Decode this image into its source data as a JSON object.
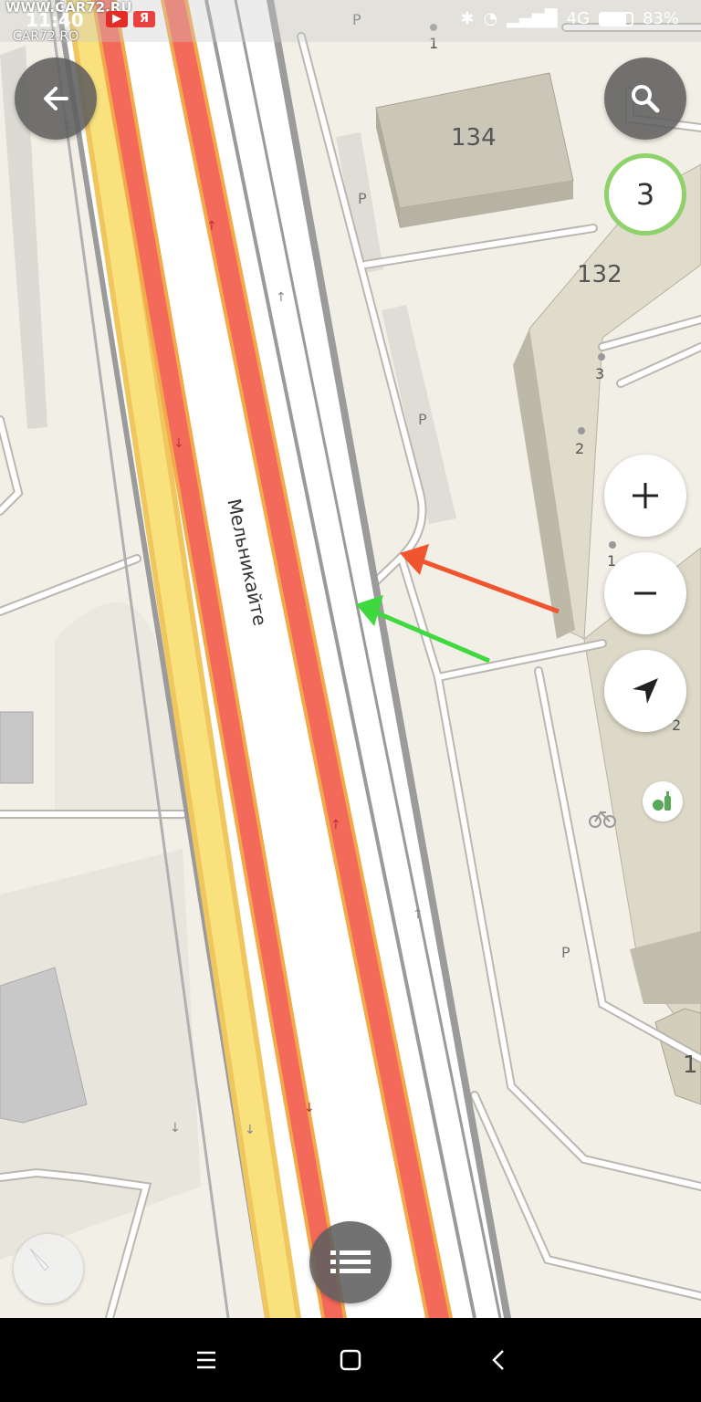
{
  "status_bar": {
    "time": "11:40",
    "network": "4G",
    "battery": "83%",
    "watermark_top": "WWW.CAR72.RU",
    "watermark_logo": "CAR72.RO",
    "yandex_badge": "Я"
  },
  "map": {
    "street_name": "Мельникайте",
    "buildings": [
      {
        "label": "134"
      },
      {
        "label": "132"
      },
      {
        "label": "1"
      }
    ],
    "house_numbers": [
      "1",
      "3",
      "2",
      "1",
      "2"
    ],
    "parking_label": "P"
  },
  "controls": {
    "back_icon": "arrow-left-icon",
    "search_icon": "search-icon",
    "layers_counter": "3",
    "zoom_in_icon": "plus-icon",
    "zoom_out_icon": "minus-icon",
    "locate_icon": "navigation-arrow-icon",
    "menu_icon": "list-icon",
    "compass_icon": "compass-icon"
  },
  "annotations": {
    "red_arrow_color": "#f0552f",
    "green_arrow_color": "#3fd93f"
  },
  "colors": {
    "map_bg": "#f2efe6",
    "road_red": "#f46a5a",
    "road_yellow": "#f9e27e",
    "building": "#c9c5b7"
  }
}
